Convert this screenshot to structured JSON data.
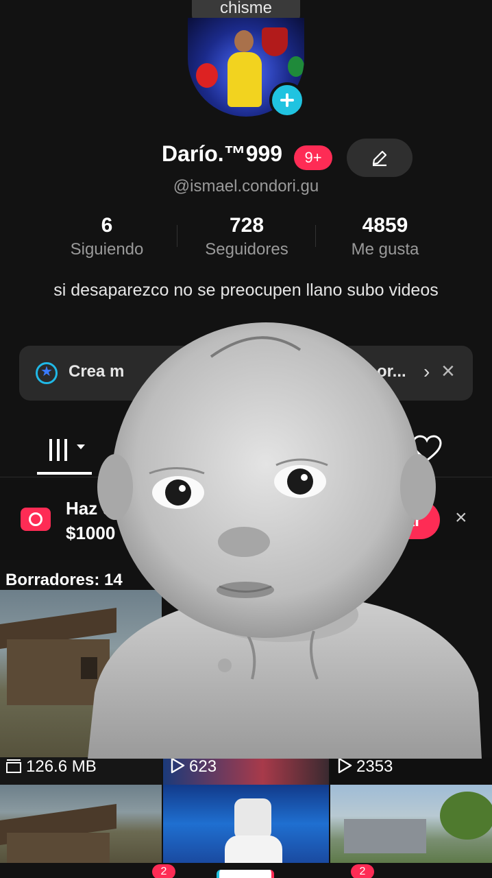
{
  "header": {
    "top_chip": "chisme"
  },
  "profile": {
    "display_name": "Darío.™999",
    "notification_badge": "9+",
    "username": "@ismael.condori.gu",
    "bio": "si desaparezco no se preocupen llano subo videos"
  },
  "stats": [
    {
      "value": "6",
      "label": "Siguiendo"
    },
    {
      "value": "728",
      "label": "Seguidores"
    },
    {
      "value": "4859",
      "label": "Me gusta"
    }
  ],
  "promo": {
    "text_start": "Crea m",
    "text_end": "or..."
  },
  "creator_banner": {
    "line1": "Haz u",
    "line2": "$1000",
    "button": "Crear"
  },
  "drafts": {
    "label": "Borradores: 14"
  },
  "grid": [
    {
      "label": "126.6 MB",
      "icon": "box-icon"
    },
    {
      "label": "623",
      "icon": "play-icon"
    },
    {
      "label": "2353",
      "icon": "play-icon"
    }
  ],
  "nav": {
    "badges": [
      "2",
      "2"
    ]
  },
  "colors": {
    "accent": "#fe2c55",
    "cyan": "#20c3e0",
    "background": "#121212"
  }
}
